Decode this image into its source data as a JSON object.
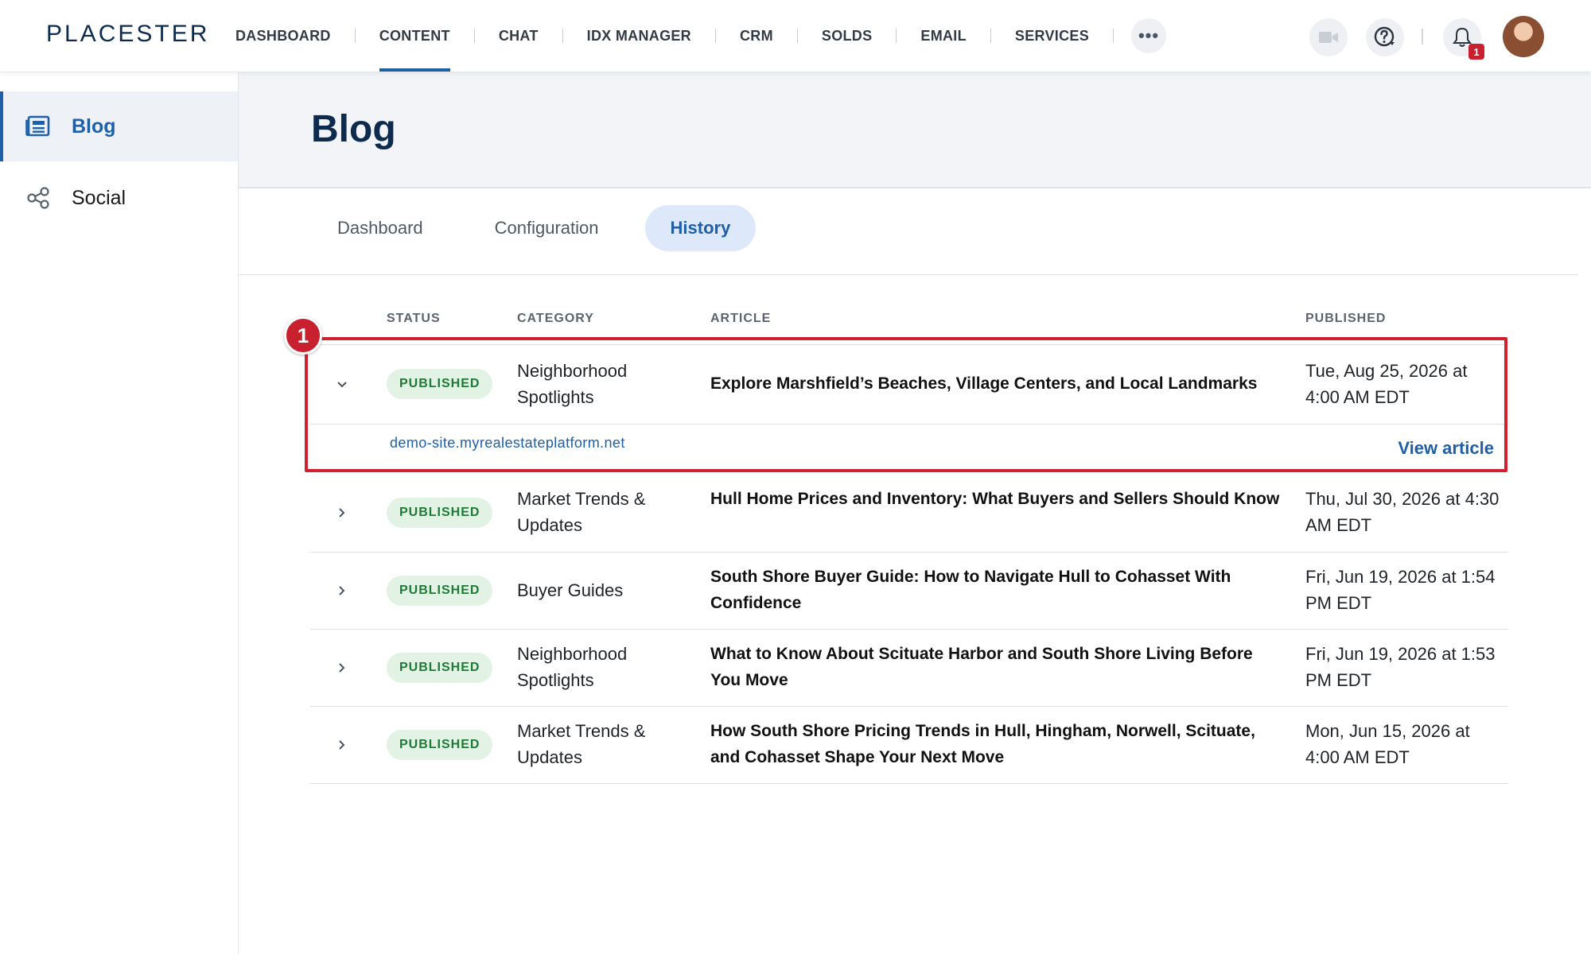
{
  "app": {
    "logo": "PLACESTER"
  },
  "nav": {
    "items": [
      {
        "label": "DASHBOARD",
        "active": false
      },
      {
        "label": "CONTENT",
        "active": true
      },
      {
        "label": "CHAT",
        "active": false
      },
      {
        "label": "IDX MANAGER",
        "active": false
      },
      {
        "label": "CRM",
        "active": false
      },
      {
        "label": "SOLDS",
        "active": false
      },
      {
        "label": "EMAIL",
        "active": false
      },
      {
        "label": "SERVICES",
        "active": false
      }
    ],
    "more_label": "•••",
    "notification_count": "1"
  },
  "sidebar": {
    "items": [
      {
        "label": "Blog",
        "icon": "newspaper-icon",
        "active": true
      },
      {
        "label": "Social",
        "icon": "share-icon",
        "active": false
      }
    ]
  },
  "page": {
    "title": "Blog"
  },
  "tabs": [
    {
      "label": "Dashboard",
      "active": false
    },
    {
      "label": "Configuration",
      "active": false
    },
    {
      "label": "History",
      "active": true
    }
  ],
  "table": {
    "headers": {
      "status": "STATUS",
      "category": "CATEGORY",
      "article": "ARTICLE",
      "published": "PUBLISHED"
    },
    "rows": [
      {
        "status": "PUBLISHED",
        "category": "Neighborhood Spotlights",
        "article": "Explore Marshfield’s Beaches, Village Centers, and Local Landmarks",
        "published": "Tue, Aug 25, 2026 at 4:00 AM EDT",
        "expanded": true,
        "site": "demo-site.myrealestateplatform.net",
        "view_label": "View article"
      },
      {
        "status": "PUBLISHED",
        "category": "Market Trends & Updates",
        "article": "Hull Home Prices and Inventory: What Buyers and Sellers Should Know",
        "published": "Thu, Jul 30, 2026 at 4:30 AM EDT"
      },
      {
        "status": "PUBLISHED",
        "category": "Buyer Guides",
        "article": "South Shore Buyer Guide: How to Navigate Hull to Cohasset With Confidence",
        "published": "Fri, Jun 19, 2026 at 1:54 PM EDT"
      },
      {
        "status": "PUBLISHED",
        "category": "Neighborhood Spotlights",
        "article": "What to Know About Scituate Harbor and South Shore Living Before You Move",
        "published": "Fri, Jun 19, 2026 at 1:53 PM EDT"
      },
      {
        "status": "PUBLISHED",
        "category": "Market Trends & Updates",
        "article": "How South Shore Pricing Trends in Hull, Hingham, Norwell, Scituate, and Cohasset Shape Your Next Move",
        "published": "Mon, Jun 15, 2026 at 4:00 AM EDT"
      }
    ]
  },
  "annotation": {
    "number": "1"
  },
  "colors": {
    "brand": "#0d2b4e",
    "accent": "#1f5fa8",
    "success": "#1e7a35",
    "annotation": "#d1212f"
  }
}
